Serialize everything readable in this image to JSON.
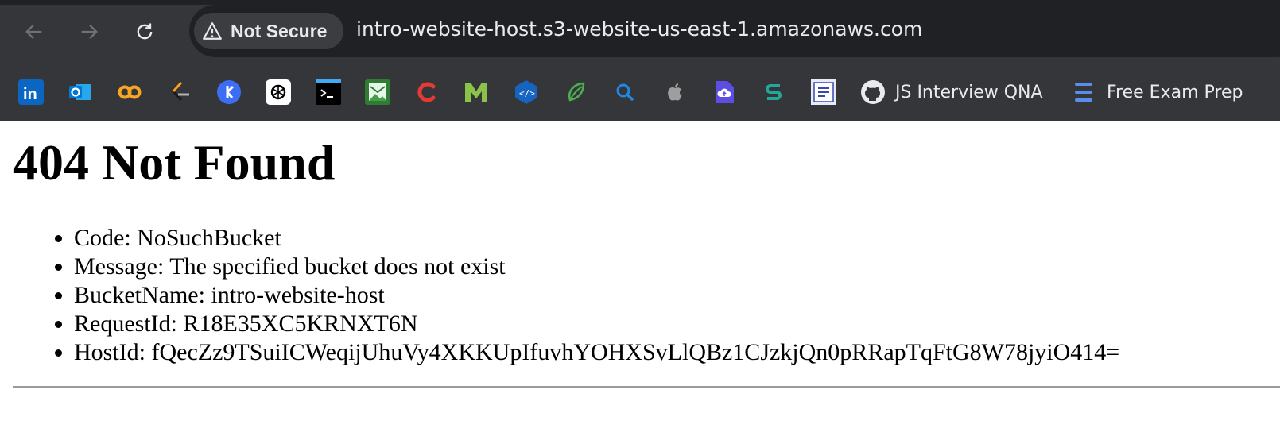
{
  "browser": {
    "security_label": "Not Secure",
    "url": "intro-website-host.s3-website-us-east-1.amazonaws.com",
    "nav": {
      "back_icon": "arrow-left-icon",
      "forward_icon": "arrow-right-icon",
      "reload_icon": "reload-icon"
    }
  },
  "bookmarks": {
    "items": [
      {
        "icon": "linkedin-icon",
        "color": "#0a66c2"
      },
      {
        "icon": "outlook-icon",
        "color": "#0078d4"
      },
      {
        "icon": "coursera-icon",
        "color": "#f5a623"
      },
      {
        "icon": "leetcode-icon",
        "color": "#ffa116"
      },
      {
        "icon": "bookmark-app-icon",
        "color": "#3b6ef5"
      },
      {
        "icon": "chatgpt-icon",
        "color": "#ffffff"
      },
      {
        "icon": "terminal-icon",
        "color": "#000000"
      },
      {
        "icon": "image-mail-icon",
        "color": "#2e7d32"
      },
      {
        "icon": "c-logo-icon",
        "color": "#e53935"
      },
      {
        "icon": "m-logo-icon",
        "color": "#8bc34a"
      },
      {
        "icon": "code-hex-icon",
        "color": "#1565c0"
      },
      {
        "icon": "leaf-icon",
        "color": "#4caf50"
      },
      {
        "icon": "search-icon",
        "color": "#1e88e5"
      },
      {
        "icon": "apple-icon",
        "color": "#9e9e9e"
      },
      {
        "icon": "cloud-upload-icon",
        "color": "#5c4ee5"
      },
      {
        "icon": "green-s-icon",
        "color": "#26a69a"
      },
      {
        "icon": "document-icon",
        "color": "#3949ab"
      }
    ],
    "github_label": "JS Interview QNA",
    "exam_label": "Free Exam Prep"
  },
  "page": {
    "title": "404 Not Found",
    "details": [
      "Code: NoSuchBucket",
      "Message: The specified bucket does not exist",
      "BucketName: intro-website-host",
      "RequestId: R18E35XC5KRNXT6N",
      "HostId: fQecZz9TSuiICWeqijUhuVy4XKKUpIfuvhYOHXSvLlQBz1CJzkjQn0pRRapTqFtG8W78jyiO414="
    ]
  }
}
